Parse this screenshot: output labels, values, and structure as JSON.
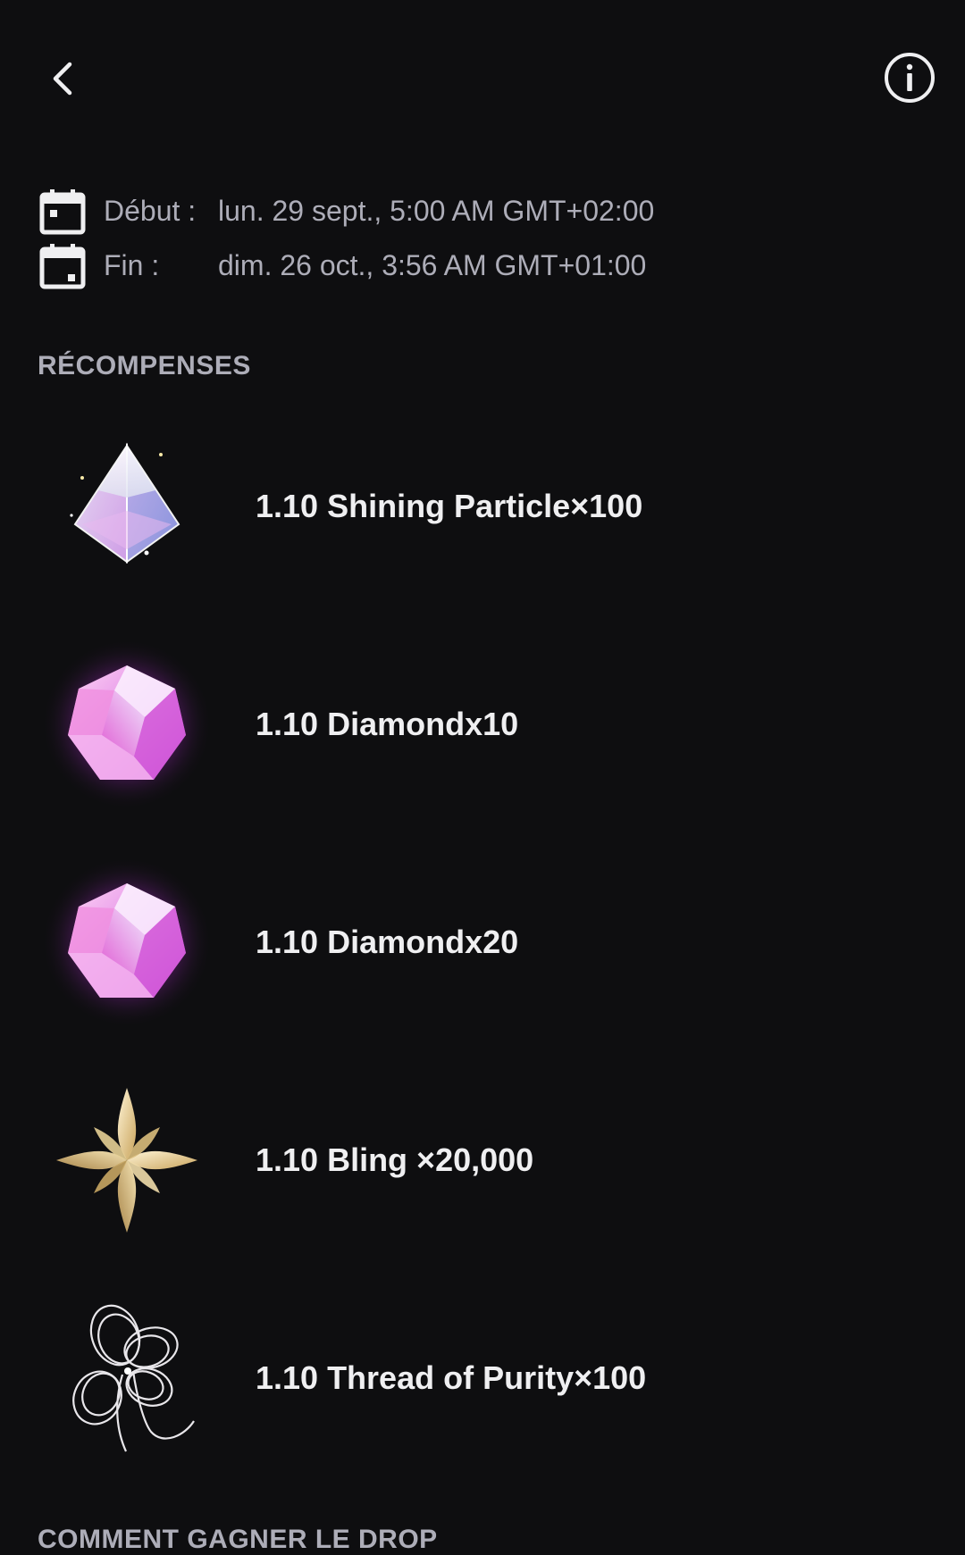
{
  "header": {
    "back_icon": "chevron-left-icon",
    "info_icon": "info-circle-icon"
  },
  "dates": {
    "start_label": "Début :",
    "start_value": "lun. 29 sept., 5:00 AM GMT+02:00",
    "end_label": "Fin :",
    "end_value": "dim. 26 oct., 3:56 AM GMT+01:00",
    "icon": "calendar-icon"
  },
  "rewards": {
    "title": "RÉCOMPENSES",
    "items": [
      {
        "name": "1.10 Shining Particle×100",
        "icon": "crystal-pyramid-icon"
      },
      {
        "name": "1.10 Diamondx10",
        "icon": "diamond-gem-icon"
      },
      {
        "name": "1.10 Diamondx20",
        "icon": "diamond-gem-icon"
      },
      {
        "name": "1.10 Bling ×20,000",
        "icon": "gold-star-icon"
      },
      {
        "name": "1.10 Thread of Purity×100",
        "icon": "thread-bow-icon"
      }
    ]
  },
  "how_to": {
    "title": "COMMENT GAGNER LE DROP"
  },
  "colors": {
    "background": "#0e0e10",
    "text_primary": "#efeff1",
    "text_secondary": "#adadb8"
  }
}
